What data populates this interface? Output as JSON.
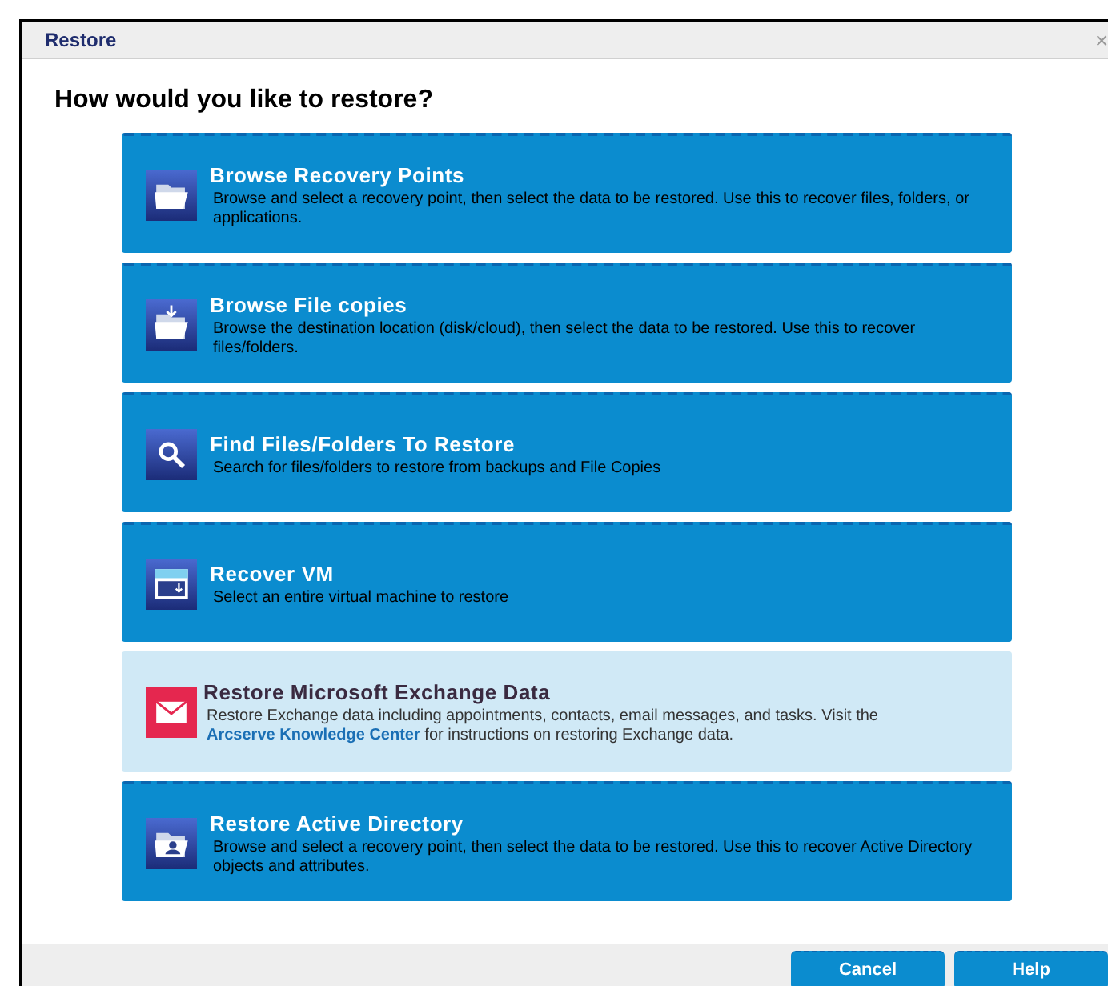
{
  "window": {
    "title": "Restore",
    "close": "×"
  },
  "heading": "How would you like to restore?",
  "options": [
    {
      "kind": "folder",
      "title": "Browse Recovery Points",
      "description": "Browse and select a recovery point, then select the data to be restored. Use this to recover files, folders, or applications.",
      "highlighted": false
    },
    {
      "kind": "download",
      "title": "Browse File copies",
      "description": "Browse the destination location (disk/cloud), then select the data to be restored. Use this to recover files/folders.",
      "highlighted": false
    },
    {
      "kind": "search",
      "title": "Find Files/Folders To Restore",
      "description": "Search for files/folders to restore from backups and File Copies",
      "highlighted": false
    },
    {
      "kind": "vm",
      "title": "Recover VM",
      "description": "Select an entire virtual machine to restore",
      "highlighted": false
    },
    {
      "kind": "mail",
      "title": "Restore Microsoft Exchange Data",
      "description": "Restore Exchange data including appointments, contacts, email messages, and tasks. Visit the",
      "link": "Arcserve Knowledge Center",
      "description_after": "for instructions on restoring Exchange data.",
      "highlighted": true
    },
    {
      "kind": "directory",
      "title": "Restore Active Directory",
      "description": "Browse and select a recovery point, then select the data to be restored. Use this to recover Active Directory objects and attributes.",
      "highlighted": false
    }
  ],
  "buttons": [
    "Cancel",
    "Help"
  ]
}
